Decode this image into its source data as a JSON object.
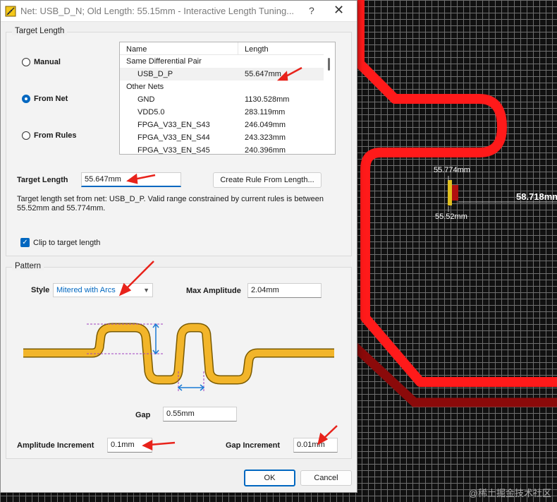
{
  "window": {
    "title": "Net: USB_D_N;  Old Length: 55.15mm  -  Interactive Length Tuning...",
    "help_icon": "?",
    "close_icon": "✕"
  },
  "target_length_group": {
    "title": "Target Length",
    "radios": [
      {
        "label": "Manual",
        "selected": false
      },
      {
        "label": "From Net",
        "selected": true
      },
      {
        "label": "From Rules",
        "selected": false
      }
    ],
    "list": {
      "columns": [
        "Name",
        "Length"
      ],
      "rows": [
        {
          "type": "group",
          "name": "Same Differential Pair"
        },
        {
          "type": "item",
          "name": "USB_D_P",
          "length": "55.647mm",
          "selected": true
        },
        {
          "type": "group",
          "name": "Other Nets"
        },
        {
          "type": "item",
          "name": "GND",
          "length": "1130.528mm"
        },
        {
          "type": "item",
          "name": "VDD5.0",
          "length": "283.119mm"
        },
        {
          "type": "item",
          "name": "FPGA_V33_EN_S43",
          "length": "246.049mm"
        },
        {
          "type": "item",
          "name": "FPGA_V33_EN_S44",
          "length": "243.323mm"
        },
        {
          "type": "item",
          "name": "FPGA_V33_EN_S45",
          "length": "240.396mm"
        }
      ]
    },
    "target_length_label": "Target Length",
    "target_length_value": "55.647mm",
    "create_rule_button": "Create Rule From Length...",
    "info_line1": "Target length set from net: USB_D_P.  Valid range constrained by current rules is between",
    "info_line2": "55.52mm and 55.774mm.",
    "clip_checkbox_label": "Clip to target length",
    "clip_checked": true
  },
  "pattern_group": {
    "title": "Pattern",
    "style_label": "Style",
    "style_value": "Mitered with Arcs",
    "max_amplitude_label": "Max Amplitude",
    "max_amplitude_value": "2.04mm",
    "gap_label": "Gap",
    "gap_value": "0.55mm",
    "amplitude_increment_label": "Amplitude Increment",
    "amplitude_increment_value": "0.1mm",
    "gap_increment_label": "Gap Increment",
    "gap_increment_value": "0.01mm"
  },
  "buttons": {
    "ok": "OK",
    "cancel": "Cancel"
  },
  "pcb": {
    "upper_value": "55.774mm",
    "lower_value": "55.52mm",
    "length_value": "58.718mm",
    "trace_color": "#ff1a1a",
    "dark_trace_color": "#8b0a0a",
    "gauge_color": "#e0c020"
  },
  "watermark": "@稀土掘金技术社区",
  "colors": {
    "accent": "#0067c0",
    "annotation_arrow": "#e8231b",
    "pattern_fill": "#f2b52a"
  }
}
